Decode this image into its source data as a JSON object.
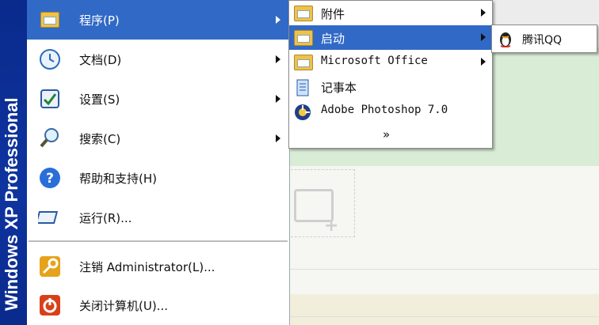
{
  "sidebar": {
    "band_text": "Windows XP Professional"
  },
  "start_menu": {
    "items": [
      {
        "label": "程序(P)",
        "icon": "programs-folder-icon",
        "highlighted": true,
        "has_submenu": true
      },
      {
        "label": "文档(D)",
        "icon": "documents-icon",
        "has_submenu": true
      },
      {
        "label": "设置(S)",
        "icon": "settings-icon",
        "has_submenu": true
      },
      {
        "label": "搜索(C)",
        "icon": "search-icon",
        "has_submenu": true
      },
      {
        "label": "帮助和支持(H)",
        "icon": "help-icon"
      },
      {
        "label": "运行(R)...",
        "icon": "run-icon"
      },
      {
        "label": "注销 Administrator(L)...",
        "icon": "logoff-icon"
      },
      {
        "label": "关闭计算机(U)...",
        "icon": "shutdown-icon"
      }
    ]
  },
  "programs_submenu": {
    "items": [
      {
        "label": "附件",
        "has_submenu": true
      },
      {
        "label": "启动",
        "has_submenu": true,
        "highlighted": true
      },
      {
        "label": "Microsoft Office",
        "has_submenu": true
      },
      {
        "label": "记事本"
      },
      {
        "label": "Adobe Photoshop 7.0"
      }
    ],
    "more": "»"
  },
  "startup_submenu": {
    "items": [
      {
        "label": "腾讯QQ"
      }
    ]
  },
  "colors": {
    "highlight": "#3169c6",
    "band": "#0e34a0"
  }
}
